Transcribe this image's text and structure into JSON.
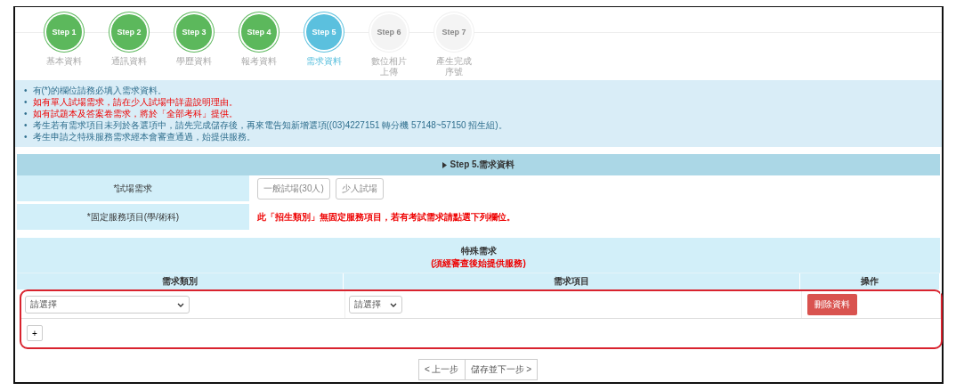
{
  "steps": [
    {
      "label": "Step 1",
      "caption": [
        "基本資料"
      ],
      "completed": true,
      "selected": false
    },
    {
      "label": "Step 2",
      "caption": [
        "通訊資料"
      ],
      "completed": true,
      "selected": false
    },
    {
      "label": "Step 3",
      "caption": [
        "學歷資料"
      ],
      "completed": true,
      "selected": false
    },
    {
      "label": "Step 4",
      "caption": [
        "報考資料"
      ],
      "completed": true,
      "selected": false
    },
    {
      "label": "Step 5",
      "caption": [
        "需求資料"
      ],
      "completed": false,
      "selected": true
    },
    {
      "label": "Step 6",
      "caption": [
        "數位相片",
        "上傳"
      ],
      "completed": false,
      "selected": false
    },
    {
      "label": "Step 7",
      "caption": [
        "產生完成",
        "序號"
      ],
      "completed": false,
      "selected": false
    }
  ],
  "notes": [
    {
      "marker": "•",
      "text": "有(*)的欄位請務必填入需求資料。",
      "highlight": false
    },
    {
      "marker": "•",
      "text": "如有單人試場需求，請在少人試場中詳盡說明理由。",
      "highlight": true
    },
    {
      "marker": "•",
      "text": "如有試題本及答案卷需求，將於「全部考科」提供。",
      "highlight": true
    },
    {
      "marker": "•",
      "text": "考生若有需求項目未列於各選項中，請先完成儲存後，再來電告知新增選項((03)4227151 轉分機 57148~57150 招生組)。",
      "highlight": false
    },
    {
      "marker": "•",
      "text": "考生申請之特殊服務需求經本會審查通過，始提供服務。",
      "highlight": false
    }
  ],
  "section_title": "Step 5.需求資料",
  "form": [
    {
      "label": "*試場需求",
      "kind": "choices",
      "options": [
        {
          "label": "一般試場(30人)",
          "selected": false
        },
        {
          "label": "少人試場",
          "selected": false
        }
      ]
    },
    {
      "label": "*固定服務項目(學/術科)",
      "kind": "message",
      "message": "此「招生類別」無固定服務項目，若有考試需求請點選下列欄位。"
    }
  ],
  "special": {
    "title": "特殊需求",
    "subtitle": "(須經審查後始提供服務)",
    "columns": [
      "需求類別",
      "需求項目",
      "操作"
    ],
    "rows": [
      {
        "category": "請選擇",
        "item": "請選擇",
        "action": "刪除資料"
      }
    ],
    "add_button": "+"
  },
  "nav": {
    "prev": "< 上一步",
    "next": "儲存並下一步 >"
  }
}
